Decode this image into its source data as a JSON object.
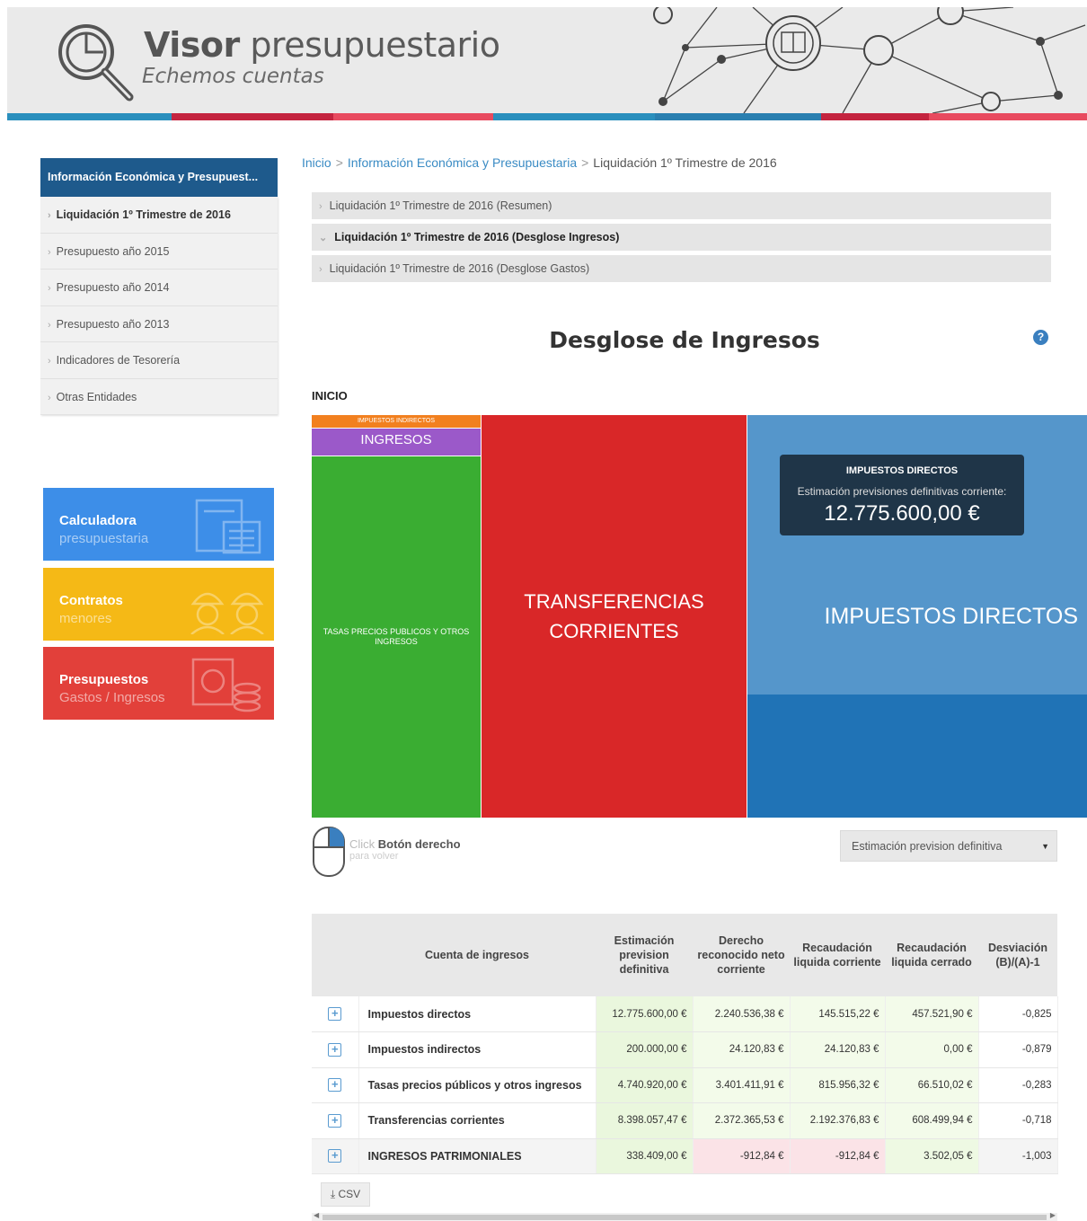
{
  "header": {
    "title_bold": "Visor",
    "title_rest": " presupuestario",
    "subtitle": "Echemos cuentas",
    "colorbar": [
      "#2a8fbd",
      "#c4243f",
      "#e84a5f",
      "#2a8fbd",
      "#2a7fb0",
      "#c4243f",
      "#e84a5f"
    ]
  },
  "sidebar": {
    "heading": "Información Económica y Presupuest...",
    "items": [
      {
        "label": "Liquidación 1º Trimestre de 2016",
        "active": true
      },
      {
        "label": "Presupuesto año 2015"
      },
      {
        "label": "Presupuesto año 2014"
      },
      {
        "label": "Presupuesto año 2013"
      },
      {
        "label": "Indicadores de Tesorería"
      },
      {
        "label": "Otras Entidades"
      }
    ]
  },
  "promos": [
    {
      "title": "Calculadora",
      "subtitle": "presupuestaria",
      "color": "#3d8ee8",
      "icon": "calculator-icon"
    },
    {
      "title": "Contratos",
      "subtitle": "menores",
      "color": "#f5b916",
      "icon": "workers-icon"
    },
    {
      "title": "Presupuestos",
      "subtitle": "Gastos / Ingresos",
      "color": "#e2403a",
      "icon": "coins-icon"
    }
  ],
  "breadcrumb": {
    "home": "Inicio",
    "section": "Información Económica y Presupuestaria",
    "current": "Liquidación 1º Trimestre de 2016"
  },
  "accordion": [
    {
      "label": "Liquidación 1º Trimestre de 2016 (Resumen)",
      "open": false
    },
    {
      "label": "Liquidación 1º Trimestre de 2016 (Desglose Ingresos)",
      "open": true
    },
    {
      "label": "Liquidación 1º Trimestre de 2016 (Desglose Gastos)",
      "open": false
    }
  ],
  "main": {
    "title": "Desglose de Ingresos",
    "help": "?",
    "level_label": "INICIO"
  },
  "treemap": {
    "tiles": [
      {
        "label": "IMPUESTOS INDIRECTOS",
        "color": "#f2801f"
      },
      {
        "label": "INGRESOS PATRIMONIALES",
        "color": "#9b59c9"
      },
      {
        "label": "TASAS PRECIOS PUBLICOS Y OTROS INGRESOS",
        "color": "#3aad32"
      },
      {
        "label": "TRANSFERENCIAS CORRIENTES",
        "color": "#d92728"
      },
      {
        "label": "IMPUESTOS DIRECTOS",
        "color": "#5596cb"
      }
    ],
    "tooltip": {
      "title": "IMPUESTOS DIRECTOS",
      "subtitle": "Estimación previsiones definitivas corriente:",
      "value": "12.775.600,00 €"
    }
  },
  "hint": {
    "click": "Click",
    "bold": "Botón derecho",
    "sub": "para volver"
  },
  "select": {
    "value": "Estimación prevision definitiva"
  },
  "table": {
    "headers": [
      "",
      "Cuenta de ingresos",
      "Estimación prevision definitiva",
      "Derecho reconocido neto corriente",
      "Recaudación liquida corriente",
      "Recaudación liquida cerrado",
      "Desviación (B)/(A)-1"
    ],
    "rows": [
      {
        "name": "Impuestos directos",
        "a": "12.775.600,00 €",
        "b": "2.240.536,38 €",
        "c": "145.515,22 €",
        "d": "457.521,90 €",
        "e": "-0,825"
      },
      {
        "name": "Impuestos indirectos",
        "a": "200.000,00 €",
        "b": "24.120,83 €",
        "c": "24.120,83 €",
        "d": "0,00 €",
        "e": "-0,879"
      },
      {
        "name": "Tasas precios públicos y otros ingresos",
        "a": "4.740.920,00 €",
        "b": "3.401.411,91 €",
        "c": "815.956,32 €",
        "d": "66.510,02 €",
        "e": "-0,283"
      },
      {
        "name": "Transferencias corrientes",
        "a": "8.398.057,47 €",
        "b": "2.372.365,53 €",
        "c": "2.192.376,83 €",
        "d": "608.499,94 €",
        "e": "-0,718"
      },
      {
        "name": "INGRESOS PATRIMONIALES",
        "a": "338.409,00 €",
        "b": "-912,84 €",
        "c": "-912,84 €",
        "d": "3.502,05 €",
        "e": "-1,003"
      }
    ]
  },
  "csv_label": "CSV"
}
